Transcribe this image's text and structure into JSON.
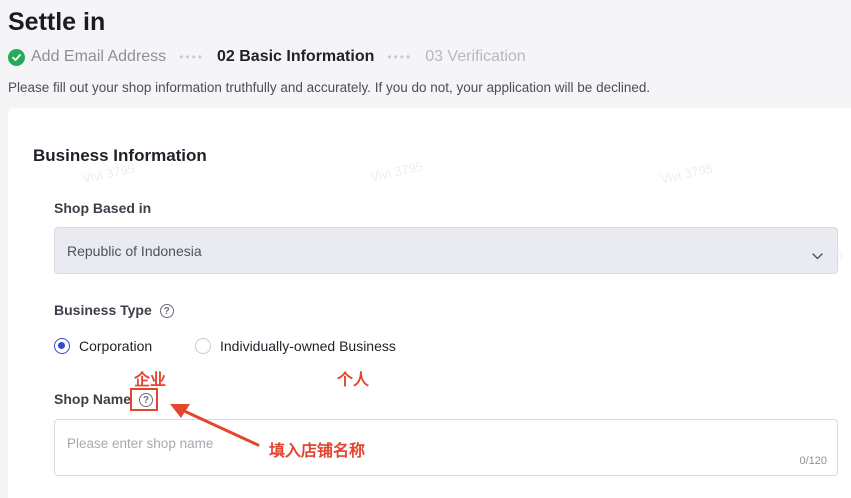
{
  "page": {
    "title": "Settle in",
    "steps": [
      {
        "label": "Add Email Address",
        "state": "done"
      },
      {
        "label": "02 Basic Information",
        "state": "active"
      },
      {
        "label": "03 Verification",
        "state": "todo"
      }
    ],
    "step_separator": "••••",
    "description": "Please fill out your shop information truthfully and accurately. If you do not, your application will be declined."
  },
  "form": {
    "section_title": "Business Information",
    "shop_based_in": {
      "label": "Shop Based in",
      "value": "Republic of Indonesia",
      "chevron_icon": "chevron-down-icon"
    },
    "business_type": {
      "label": "Business Type",
      "help_glyph": "?",
      "options": [
        {
          "label": "Corporation",
          "checked": true
        },
        {
          "label": "Individually-owned Business",
          "checked": false
        }
      ]
    },
    "shop_name": {
      "label": "Shop Name",
      "help_glyph": "?",
      "placeholder": "Please enter shop name",
      "counter": "0/120"
    }
  },
  "annotations": {
    "corporation_note": "企业",
    "individual_note": "个人",
    "shop_name_note": "填入店铺名称"
  },
  "watermark": "Vivi 3795",
  "colors": {
    "success": "#27a95a",
    "accent": "#3b47c9",
    "annotation": "#e3452d"
  }
}
